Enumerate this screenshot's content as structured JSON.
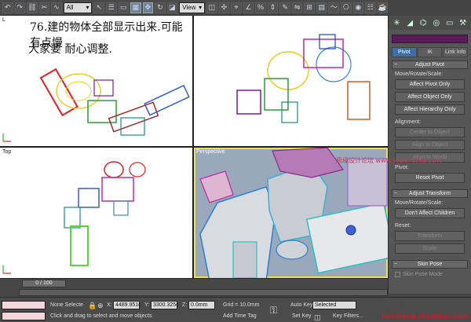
{
  "toolbar": {
    "filter_select": "All",
    "refcoord_select": "View"
  },
  "viewports": {
    "left_label": "L",
    "top_label": "Top",
    "persp_label": "Perspective",
    "caption_line1": "76.建的物体全部显示出来.可能有点慢",
    "caption_line2": "大家要  耐心调整."
  },
  "panel": {
    "tabs": [
      "Pivot",
      "IK",
      "Link Info"
    ],
    "adjust_pivot_title": "Adjust Pivot",
    "move_rotate_scale_label": "Move/Rotate/Scale:",
    "affect_pivot_only": "Affect Pivot Only",
    "affect_object_only": "Affect Object Only",
    "affect_hierarchy_only": "Affect Hierarchy Only",
    "alignment_label": "Alignment:",
    "center_to_object": "Center to Object",
    "align_to_object": "Align to Object",
    "align_to_world": "Align to World",
    "pivot_label": "Pivot:",
    "reset_pivot": "Reset Pivot",
    "adjust_transform_title": "Adjust Transform",
    "move_rotate_scale_label2": "Move/Rotate/Scale:",
    "dont_affect_children": "Don't Affect Children",
    "reset_label": "Reset:",
    "transform_btn": "Transform",
    "scale_btn": "Scale",
    "skin_pose_title": "Skin Pose",
    "skin_pose_mode": "Skin Pose Mode"
  },
  "timeline": {
    "frame": "0 / 100"
  },
  "status": {
    "selection": "None Selecte",
    "x_label": "X:",
    "x_value": "4489.951c",
    "y_label": "Y:",
    "y_value": "3300.325c",
    "z_label": "Z:",
    "z_value": "0.0mm",
    "grid": "Grid = 10.0mm",
    "auto_key": "Auto Key",
    "selected": "Selected",
    "set_key": "Set Key",
    "key_filters": "Key Filters...",
    "add_time_tag": "Add Time Tag",
    "prompt": "Click and drag to select and move objects"
  },
  "watermarks": {
    "top": "思缘设计论坛 www.MISSYUAN.COM",
    "bottom_cn": "查字典 教程网",
    "bottom_url": "jiaocheng.chazidian.com"
  }
}
